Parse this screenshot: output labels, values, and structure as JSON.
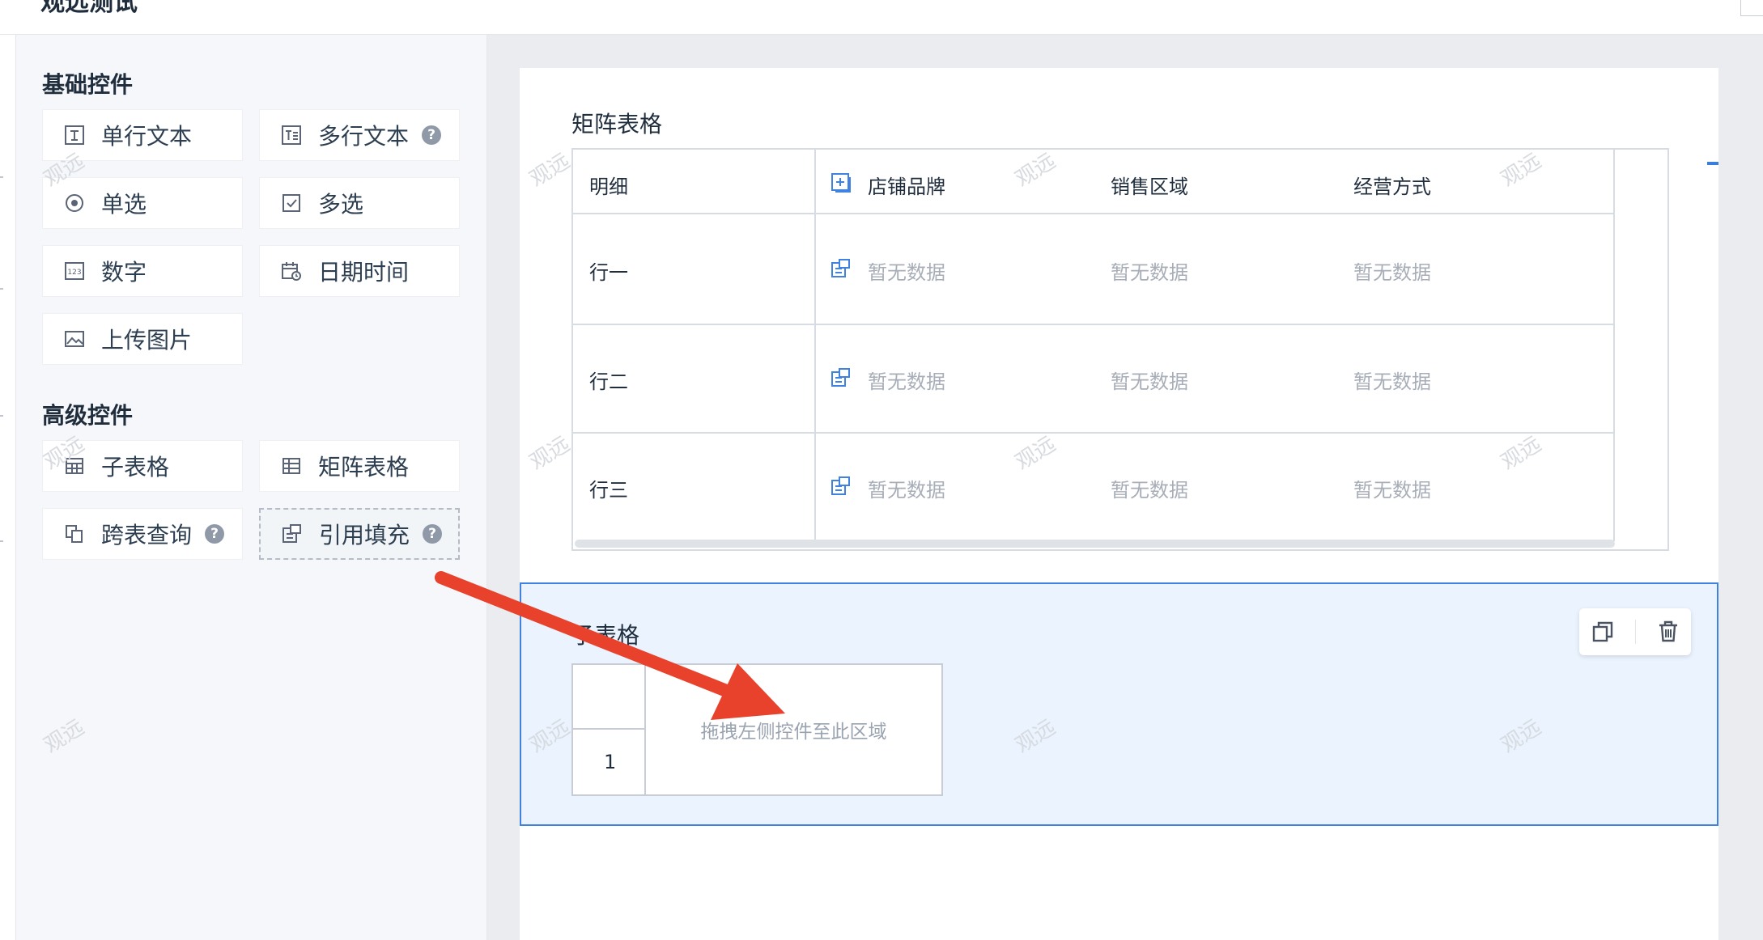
{
  "header": {
    "title": "观远测试"
  },
  "panel": {
    "basic_title": "基础控件",
    "advanced_title": "高级控件",
    "basic": [
      {
        "label": "单行文本",
        "icon": "text-line-icon",
        "help": false
      },
      {
        "label": "多行文本",
        "icon": "text-multiline-icon",
        "help": true
      },
      {
        "label": "单选",
        "icon": "radio-icon",
        "help": false
      },
      {
        "label": "多选",
        "icon": "checkbox-icon",
        "help": false
      },
      {
        "label": "数字",
        "icon": "number-icon",
        "help": false
      },
      {
        "label": "日期时间",
        "icon": "calendar-icon",
        "help": false
      },
      {
        "label": "上传图片",
        "icon": "image-icon",
        "help": false
      }
    ],
    "advanced": [
      {
        "label": "子表格",
        "icon": "subtable-icon",
        "help": false
      },
      {
        "label": "矩阵表格",
        "icon": "matrix-table-icon",
        "help": false
      },
      {
        "label": "跨表查询",
        "icon": "cross-query-icon",
        "help": true
      },
      {
        "label": "引用填充",
        "icon": "reference-fill-icon",
        "help": true
      }
    ],
    "help_glyph": "?"
  },
  "matrix": {
    "title": "矩阵表格",
    "header_first": "明细",
    "columns": [
      "店铺品牌",
      "销售区域",
      "经营方式"
    ],
    "rows": [
      "行一",
      "行二",
      "行三"
    ],
    "empty_text": "暂无数据"
  },
  "subtable": {
    "title": "子表格",
    "row_number": "1",
    "drop_hint": "拖拽左侧控件至此区域"
  },
  "watermark": "观远",
  "colors": {
    "accent": "#3f82e0",
    "arrow": "#e8412c",
    "selected_bg": "#eaf3fe"
  }
}
